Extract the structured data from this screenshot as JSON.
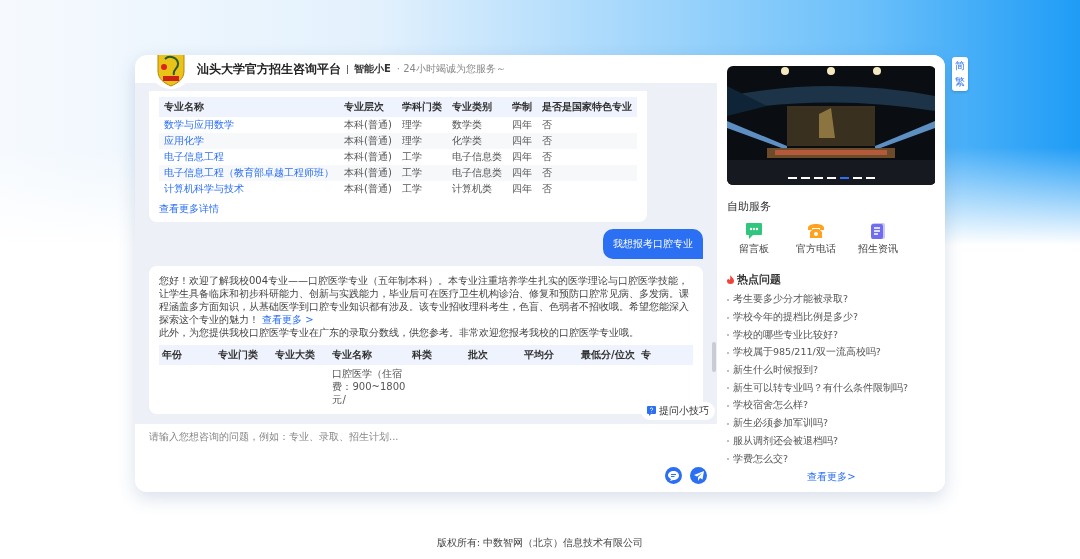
{
  "header": {
    "title": "汕头大学官方招生咨询平台",
    "assistant_name": "智能小E",
    "tagline": "· 24小时竭诚为您服务～"
  },
  "language_toggle": [
    {
      "label": "简"
    },
    {
      "label": "繁"
    }
  ],
  "messages": [
    {
      "kind": "table",
      "columns": [
        "专业名称",
        "专业层次",
        "学科门类",
        "专业类别",
        "学制",
        "是否是国家特色专业"
      ],
      "rows": [
        [
          "数学与应用数学",
          "本科(普通)",
          "理学",
          "数学类",
          "四年",
          "否"
        ],
        [
          "应用化学",
          "本科(普通)",
          "理学",
          "化学类",
          "四年",
          "否"
        ],
        [
          "电子信息工程",
          "本科(普通)",
          "工学",
          "电子信息类",
          "四年",
          "否"
        ],
        [
          "电子信息工程（教育部卓越工程师班）",
          "本科(普通)",
          "工学",
          "电子信息类",
          "四年",
          "否"
        ],
        [
          "计算机科学与技术",
          "本科(普通)",
          "工学",
          "计算机类",
          "四年",
          "否"
        ]
      ],
      "link": "查看更多详情"
    },
    {
      "kind": "text",
      "text": "我想报考口腔专业"
    },
    {
      "kind": "answer",
      "paragraphs": [
        {
          "text": "您好！欢迎了解我校004专业——口腔医学专业（五年制本科）。本专业注重培养学生扎实的医学理论与口腔医学技能，让学生具备临床和初步科研能力、创新与实践能力，毕业后可在医疗卫生机构诊治、修复和预防口腔常见病、多发病。课程涵盖多方面知识，从基础医学到口腔专业知识都有涉及。该专业招收理科考生，色盲、色弱者不招收哦。希望您能深入探索这个专业的魅力！",
          "link": "查看更多 >"
        },
        {
          "text": "此外，为您提供我校口腔医学专业在广东的录取分数线，供您参考。非常欢迎您报考我校的口腔医学专业哦。"
        }
      ],
      "table": {
        "columns": [
          "年份",
          "专业门类",
          "专业大类",
          "专业名称",
          "科类",
          "批次",
          "平均分",
          "最低分/位次",
          "专"
        ],
        "rows": [
          [
            null,
            null,
            null,
            "口腔医学（住宿费：900~1800元/",
            null,
            null,
            null,
            null,
            null
          ]
        ]
      }
    }
  ],
  "tips_button": "提问小技巧",
  "input": {
    "placeholder": "请输入您想咨询的问题，例如：专业、录取、招生计划..."
  },
  "side": {
    "carousel": {
      "kind": "picture",
      "dots": [
        {
          "selected": false
        },
        {
          "selected": false
        },
        {
          "selected": false
        },
        {
          "selected": false
        },
        {
          "selected": true
        },
        {
          "selected": false
        },
        {
          "selected": false
        }
      ]
    },
    "services_title": "自助服务",
    "services": [
      {
        "kind": "message",
        "label": "留言板"
      },
      {
        "kind": "phone",
        "label": "官方电话"
      },
      {
        "kind": "news",
        "label": "招生资讯"
      }
    ],
    "hot_title": "热点问题",
    "questions": [
      "考生要多少分才能被录取?",
      "学校今年的提档比例是多少?",
      "学校的哪些专业比较好?",
      "学校属于985/211/双一流高校吗?",
      "新生什么时候报到?",
      "新生可以转专业吗？有什么条件限制吗?",
      "学校宿舍怎么样?",
      "新生必须参加军训吗?",
      "服从调剂还会被退档吗?",
      "学费怎么交?"
    ],
    "more": "查看更多>"
  },
  "footer": "版权所有: 中数智网（北京）信息技术有限公司"
}
